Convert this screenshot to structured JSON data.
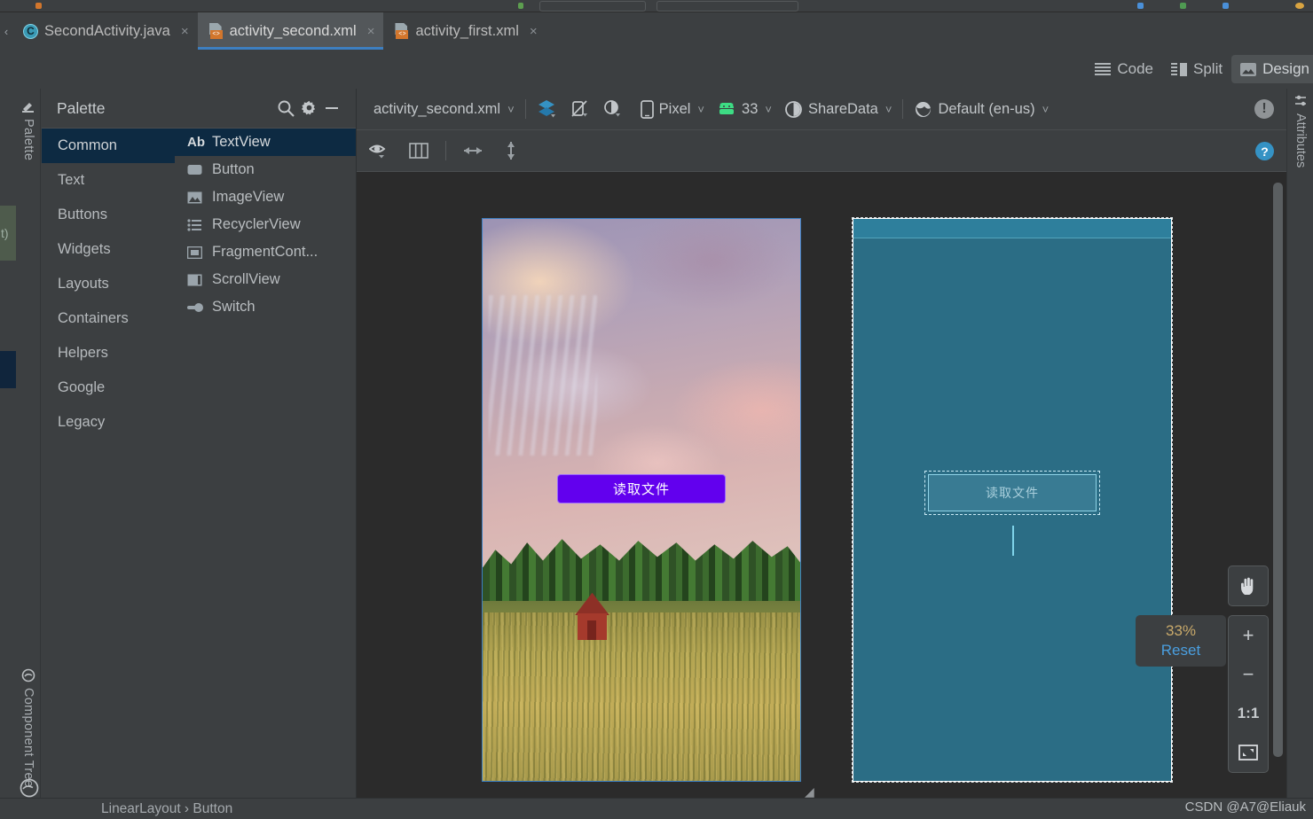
{
  "window": {
    "watermark": "CSDN @A7@Eliauk"
  },
  "tabs": [
    {
      "label": "SecondActivity.java",
      "icon": "java-class-icon",
      "active": false,
      "close": "×"
    },
    {
      "label": "activity_second.xml",
      "icon": "xml-layout-icon",
      "active": true,
      "close": "×"
    },
    {
      "label": "activity_first.xml",
      "icon": "xml-layout-icon",
      "active": false,
      "close": "×"
    }
  ],
  "editor_modes": {
    "code": "Code",
    "split": "Split",
    "design": "Design",
    "selected": "Design"
  },
  "left_strip": {
    "palette_tab": "Palette",
    "component_tree_tab": "Component Tree"
  },
  "right_strip": {
    "attributes_tab": "Attributes"
  },
  "palette": {
    "title": "Palette",
    "search_icon": "search-icon",
    "settings_icon": "gear-icon",
    "minimize_icon": "minimize-icon",
    "categories": [
      {
        "label": "Common",
        "selected": true
      },
      {
        "label": "Text",
        "selected": false
      },
      {
        "label": "Buttons",
        "selected": false
      },
      {
        "label": "Widgets",
        "selected": false
      },
      {
        "label": "Layouts",
        "selected": false
      },
      {
        "label": "Containers",
        "selected": false
      },
      {
        "label": "Helpers",
        "selected": false
      },
      {
        "label": "Google",
        "selected": false
      },
      {
        "label": "Legacy",
        "selected": false
      }
    ],
    "items": [
      {
        "label": "TextView",
        "icon": "textview-icon",
        "selected": true
      },
      {
        "label": "Button",
        "icon": "button-icon",
        "selected": false
      },
      {
        "label": "ImageView",
        "icon": "imageview-icon",
        "selected": false
      },
      {
        "label": "RecyclerView",
        "icon": "recyclerview-icon",
        "selected": false
      },
      {
        "label": "FragmentCont...",
        "icon": "fragment-container-icon",
        "selected": false
      },
      {
        "label": "ScrollView",
        "icon": "scrollview-icon",
        "selected": false
      },
      {
        "label": "Switch",
        "icon": "switch-icon",
        "selected": false
      }
    ]
  },
  "config_toolbar": {
    "file_variant": "activity_second.xml",
    "design_surface_icon": "layers-icon",
    "orientation_icon": "rotate-device-icon",
    "theme_icon": "theme-contrast-icon",
    "device": "Pixel",
    "device_icon": "phone-icon",
    "api_level": "33",
    "api_icon": "android-robot-icon",
    "theme": "ShareData",
    "theme_picker_icon": "theme-circle-icon",
    "locale": "Default (en-us)",
    "locale_icon": "globe-icon",
    "warning_icon": "warning-badge-icon"
  },
  "view_toolbar": {
    "visibility_icon": "eye-icon",
    "panes_icon": "split-panes-icon",
    "width_icon": "horizontal-resize-icon",
    "height_icon": "vertical-resize-icon",
    "help_icon": "help-icon"
  },
  "canvas": {
    "render_wrench_icon": "wrench-icon",
    "blueprint_wrench_icon": "wrench-icon",
    "render_button_label": "读取文件",
    "blueprint_button_label": "读取文件",
    "resize_handle_icon": "resize-corner-icon",
    "zoom_percent": "33%",
    "zoom_reset": "Reset",
    "controls": {
      "pan": "pan-hand-icon",
      "zoom_in": "+",
      "zoom_out": "−",
      "actual_size": "1:1",
      "zoom_to_fit": "zoom-to-fit-icon"
    },
    "accent_selection": "#3d7fc1",
    "blueprint_bg": "#2b6d85",
    "button_color": "#6200ee"
  },
  "status_bar": {
    "breadcrumb": "LinearLayout  ›  Button"
  }
}
